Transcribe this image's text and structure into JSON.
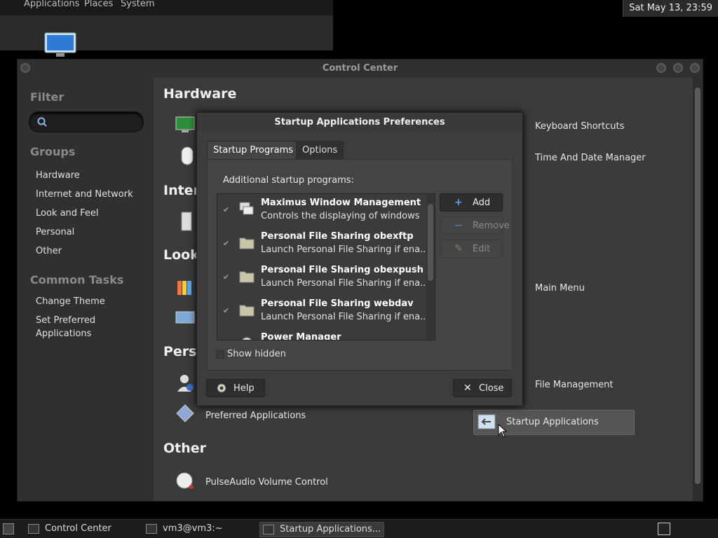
{
  "top_panel": {
    "menus": [
      "Applications",
      "Places",
      "System"
    ],
    "clock": "Sat May 13, 23:59"
  },
  "control_center": {
    "title": "Control Center",
    "sidebar": {
      "filter_heading": "Filter",
      "search_placeholder": "",
      "groups_heading": "Groups",
      "groups": [
        "Hardware",
        "Internet and Network",
        "Look and Feel",
        "Personal",
        "Other"
      ],
      "common_tasks_heading": "Common Tasks",
      "tasks": [
        "Change Theme",
        "Set Preferred Applications"
      ]
    },
    "sections": {
      "hardware": "Hardware",
      "internet": "Inter",
      "look": "Look",
      "personal": "Perso",
      "other": "Other"
    },
    "apps": {
      "keyboard_shortcuts": "Keyboard Shortcuts",
      "time_date": "Time And Date Manager",
      "main_menu": "Main Menu",
      "file_management": "File Management",
      "preferred_apps": "Preferred Applications",
      "startup_apps": "Startup Applications",
      "pulseaudio": "PulseAudio Volume Control"
    }
  },
  "dialog": {
    "title": "Startup Applications Preferences",
    "tabs": [
      "Startup Programs",
      "Options"
    ],
    "list_label": "Additional startup programs:",
    "programs": [
      {
        "name": "Maximus Window Management",
        "desc": "Controls the displaying of windows",
        "checked": true
      },
      {
        "name": "Personal File Sharing obexftp",
        "desc": "Launch Personal File Sharing if ena...",
        "checked": true
      },
      {
        "name": "Personal File Sharing obexpush",
        "desc": "Launch Personal File Sharing if ena...",
        "checked": true
      },
      {
        "name": "Personal File Sharing webdav",
        "desc": "Launch Personal File Sharing if ena...",
        "checked": true
      },
      {
        "name": "Power Manager",
        "desc": "",
        "checked": true
      }
    ],
    "buttons": {
      "add": "Add",
      "remove": "Remove",
      "edit": "Edit"
    },
    "show_hidden": "Show hidden",
    "help": "Help",
    "close": "Close"
  },
  "taskbar": {
    "items": [
      "Control Center",
      "vm3@vm3:~",
      "Startup Applications..."
    ]
  }
}
